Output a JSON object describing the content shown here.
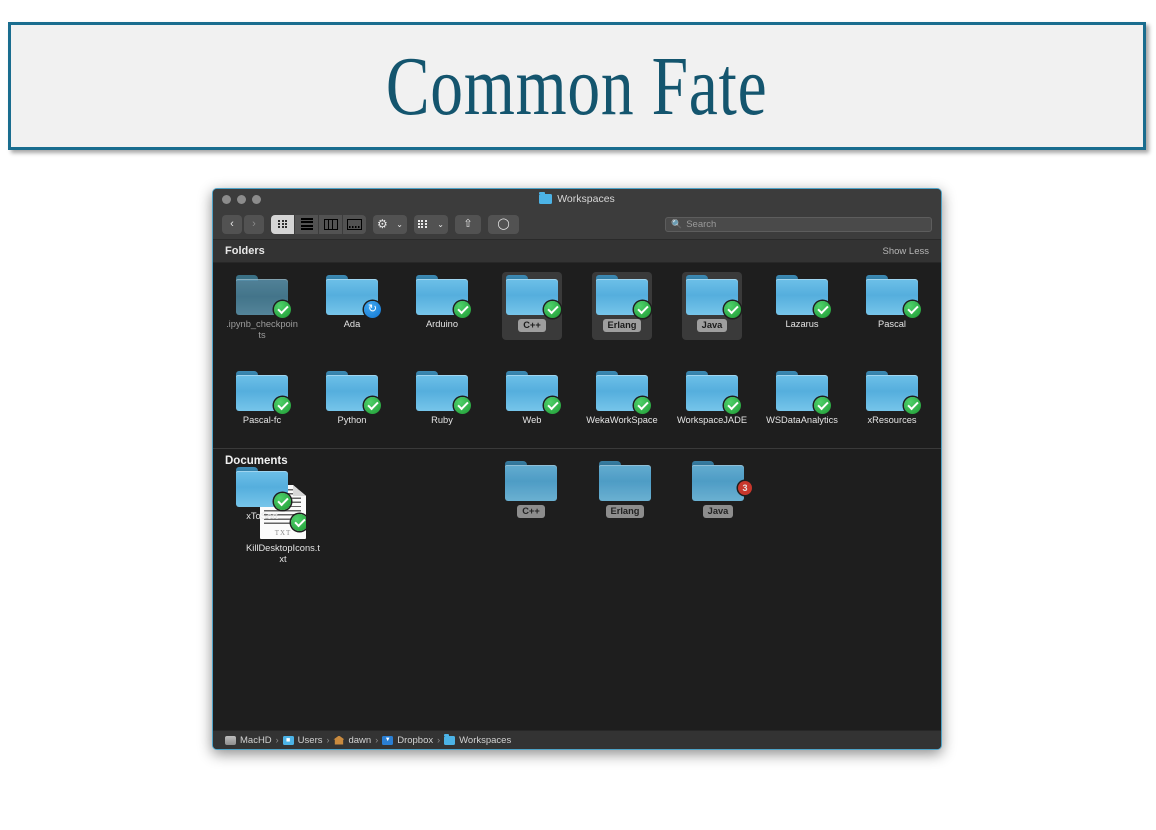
{
  "banner": {
    "title": "Common Fate"
  },
  "finder": {
    "window_title": "Workspaces",
    "toolbar": {
      "back": "‹",
      "forward": "›",
      "view_icon": "icon-view",
      "view_list": "list-view",
      "view_column": "column-view",
      "view_gallery": "gallery-view",
      "action_menu": "gear",
      "group_menu": "group-by",
      "share": "share",
      "tag": "tag",
      "chevron": "⌄"
    },
    "search": {
      "placeholder": "Search",
      "value": ""
    },
    "sections": [
      {
        "header": "Folders",
        "action": "Show Less"
      },
      {
        "header": "Documents",
        "action": ""
      }
    ],
    "folders": [
      {
        "name": ".ipynb_checkpoints",
        "badge": "ok",
        "dim": true,
        "selected": false
      },
      {
        "name": "Ada",
        "badge": "sync",
        "dim": false,
        "selected": false
      },
      {
        "name": "Arduino",
        "badge": "ok",
        "dim": false,
        "selected": false
      },
      {
        "name": "C++",
        "badge": "ok",
        "dim": false,
        "selected": true
      },
      {
        "name": "Erlang",
        "badge": "ok",
        "dim": false,
        "selected": true
      },
      {
        "name": "Java",
        "badge": "ok",
        "dim": false,
        "selected": true
      },
      {
        "name": "Lazarus",
        "badge": "ok",
        "dim": false,
        "selected": false
      },
      {
        "name": "Pascal",
        "badge": "ok",
        "dim": false,
        "selected": false
      },
      {
        "name": "Pascal-fc",
        "badge": "ok",
        "dim": false,
        "selected": false
      },
      {
        "name": "Python",
        "badge": "ok",
        "dim": false,
        "selected": false
      },
      {
        "name": "Ruby",
        "badge": "ok",
        "dim": false,
        "selected": false
      },
      {
        "name": "Web",
        "badge": "ok",
        "dim": false,
        "selected": false
      },
      {
        "name": "WekaWorkSpace",
        "badge": "ok",
        "dim": false,
        "selected": false
      },
      {
        "name": "WorkspaceJADE",
        "badge": "ok",
        "dim": false,
        "selected": false
      },
      {
        "name": "WSDataAnalytics",
        "badge": "ok",
        "dim": false,
        "selected": false
      },
      {
        "name": "xResources",
        "badge": "ok",
        "dim": false,
        "selected": false
      },
      {
        "name": "xToSort",
        "badge": "ok",
        "dim": false,
        "selected": false
      }
    ],
    "documents": [
      {
        "name": "KillDesktopIcons.txt",
        "type": "text-file",
        "badge": "ok",
        "txt_label": "TXT"
      }
    ],
    "drag_cluster": {
      "items": [
        {
          "name": "C++"
        },
        {
          "name": "Erlang"
        },
        {
          "name": "Java"
        }
      ],
      "count_badge": "3"
    },
    "path_bar": [
      {
        "label": "MacHD",
        "icon": "hard-drive-icon"
      },
      {
        "label": "Users",
        "icon": "users-folder-icon"
      },
      {
        "label": "dawn",
        "icon": "home-folder-icon"
      },
      {
        "label": "Dropbox",
        "icon": "dropbox-folder-icon"
      },
      {
        "label": "Workspaces",
        "icon": "folder-icon"
      }
    ],
    "path_separator": "›"
  },
  "colors": {
    "banner_border": "#1a6d8f",
    "banner_bg": "#f1f1f1",
    "title_text": "#14556e",
    "window_bg": "#1e1e1e",
    "chrome": "#3c3c3c",
    "folder_blue": "#55aedd",
    "badge_green": "#1e9b34",
    "badge_blue": "#1276d2",
    "badge_red": "#e03b2f"
  }
}
